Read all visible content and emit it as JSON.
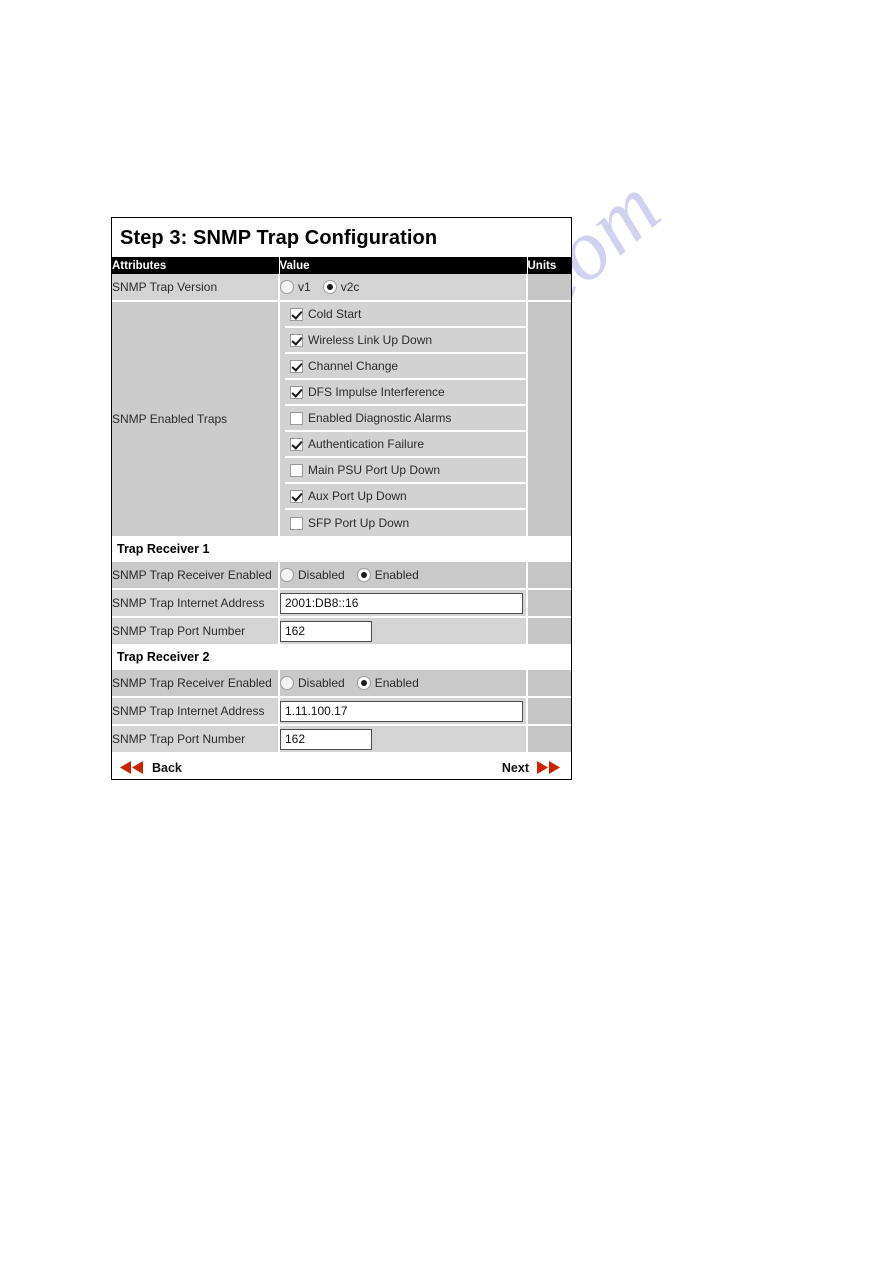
{
  "watermark": {
    "text": "manualshive.com"
  },
  "panel": {
    "title": "Step 3: SNMP Trap Configuration",
    "columns": {
      "attributes": "Attributes",
      "value": "Value",
      "units": "Units"
    },
    "version_row": {
      "label": "SNMP Trap Version",
      "options": [
        {
          "label": "v1",
          "selected": false
        },
        {
          "label": "v2c",
          "selected": true
        }
      ]
    },
    "traps_row": {
      "label": "SNMP Enabled Traps",
      "items": [
        {
          "label": "Cold Start",
          "checked": true
        },
        {
          "label": "Wireless Link Up Down",
          "checked": true
        },
        {
          "label": "Channel Change",
          "checked": true
        },
        {
          "label": "DFS Impulse Interference",
          "checked": true
        },
        {
          "label": "Enabled Diagnostic Alarms",
          "checked": false
        },
        {
          "label": "Authentication Failure",
          "checked": true
        },
        {
          "label": "Main PSU Port Up Down",
          "checked": false
        },
        {
          "label": "Aux Port Up Down",
          "checked": true
        },
        {
          "label": "SFP Port Up Down",
          "checked": false
        }
      ]
    },
    "receivers": [
      {
        "section_label": "Trap Receiver 1",
        "enabled_label": "SNMP Trap Receiver Enabled",
        "enabled_options": [
          {
            "label": "Disabled",
            "selected": false
          },
          {
            "label": "Enabled",
            "selected": true
          }
        ],
        "address_label": "SNMP Trap Internet Address",
        "address_value": "2001:DB8::16",
        "port_label": "SNMP Trap Port Number",
        "port_value": "162"
      },
      {
        "section_label": "Trap Receiver 2",
        "enabled_label": "SNMP Trap Receiver Enabled",
        "enabled_options": [
          {
            "label": "Disabled",
            "selected": false
          },
          {
            "label": "Enabled",
            "selected": true
          }
        ],
        "address_label": "SNMP Trap Internet Address",
        "address_value": "1.11.100.17",
        "port_label": "SNMP Trap Port Number",
        "port_value": "162"
      }
    ],
    "nav": {
      "back_label": "Back",
      "next_label": "Next",
      "arrow_color": "#cc2200"
    }
  }
}
